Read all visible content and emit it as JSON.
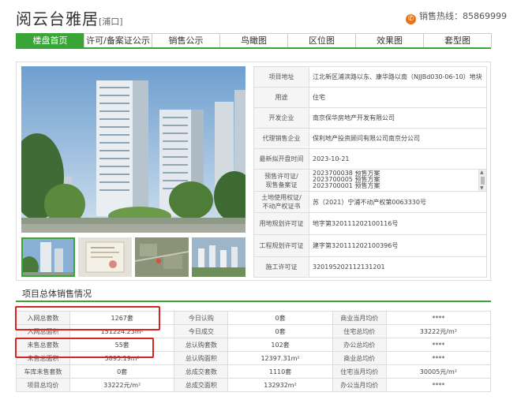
{
  "header": {
    "title": "阅云台雅居",
    "district": "[浦口]",
    "hotline_label": "销售热线：",
    "hotline_number": "85869999"
  },
  "tabs": [
    {
      "label": "楼盘首页",
      "active": true
    },
    {
      "label": "许可/备案证公示",
      "active": false
    },
    {
      "label": "销售公示",
      "active": false
    },
    {
      "label": "鸟瞰图",
      "active": false
    },
    {
      "label": "区位图",
      "active": false
    },
    {
      "label": "效果图",
      "active": false
    },
    {
      "label": "套型图",
      "active": false
    }
  ],
  "project_info": {
    "address_label": "项目地址",
    "address": "江北新区浦滨路以东、康华路以南（NJJBd030-06-10）地块",
    "usage_label": "用途",
    "usage": "住宅",
    "developer_label": "开发企业",
    "developer": "南京保华房地产开发有限公司",
    "agent_label": "代理销售企业",
    "agent": "保利地产投资顾问有限公司南京分公司",
    "open_date_label": "最新拟开盘时间",
    "open_date": "2023-10-21",
    "presale_label_1": "预售许可证/",
    "presale_label_2": "现售备案证",
    "presale_lines": [
      "2023700038    预售方案",
      "2023700005    预售方案",
      "2023700001    预售方案"
    ],
    "land_label_1": "土地使用权证/",
    "land_label_2": "不动产权证书",
    "land": "苏（2021）宁浦不动产权第0063330号",
    "land_plan_label": "用地规划许可证",
    "land_plan": "地字第320111202100116号",
    "build_plan_label": "工程规划许可证",
    "build_plan": "建字第320111202100396号",
    "construction_label": "施工许可证",
    "construction": "320195202112131201"
  },
  "section_title": "项目总体销售情况",
  "stats": {
    "rows": [
      [
        "入网总套数",
        "1267套",
        "今日认购",
        "0套",
        "商业当月均价",
        "****"
      ],
      [
        "入网总面积",
        "151224.23m²",
        "今日成交",
        "0套",
        "住宅总均价",
        "33222元/m²"
      ],
      [
        "未售总套数",
        "55套",
        "总认购套数",
        "102套",
        "办公总均价",
        "****"
      ],
      [
        "未售总面积",
        "5895.19m²",
        "总认购面积",
        "12397.31m²",
        "商业总均价",
        "****"
      ],
      [
        "车库未售套数",
        "0套",
        "总成交套数",
        "1110套",
        "住宅当月均价",
        "30005元/m²"
      ],
      [
        "项目总均价",
        "33222元/m²",
        "总成交面积",
        "132932m²",
        "办公当月均价",
        "****"
      ]
    ]
  },
  "colors": {
    "accent_green": "#3aa537",
    "highlight_red": "#d8251f",
    "phone_orange": "#e8731a"
  }
}
